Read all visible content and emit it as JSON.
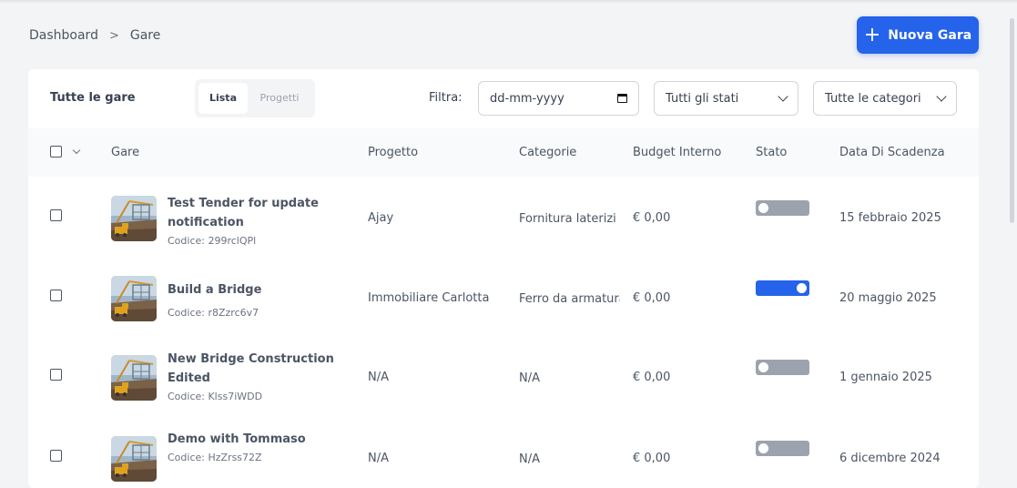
{
  "breadcrumb": {
    "items": [
      "Dashboard",
      "Gare"
    ],
    "separator": ">"
  },
  "header": {
    "new_button_label": "Nuova Gara",
    "new_button_icon": "plus-icon"
  },
  "toolbar": {
    "title": "Tutte le gare",
    "view_options": [
      "Lista",
      "Progetti"
    ],
    "active_view": "Lista",
    "filter_label": "Filtra:",
    "date_placeholder": "dd-mm-yyyy",
    "status_select": "Tutti gli stati",
    "category_select": "Tutte le categorie"
  },
  "table": {
    "columns": [
      "Gare",
      "Progetto",
      "Categorie",
      "Budget Interno",
      "Stato",
      "Data Di Scadenza"
    ],
    "rows": [
      {
        "name": "Test Tender for update notification",
        "code": "Codice: 299rclQPl",
        "project": "Ajay",
        "category": "Fornitura laterizi",
        "budget": "€ 0,00",
        "status_on": false,
        "deadline": "15 febbraio 2025"
      },
      {
        "name": "Build a Bridge",
        "code": "Codice: r8Zzrc6v7",
        "project": "Immobiliare Carlotta",
        "category": "Ferro da armatura",
        "budget": "€ 0,00",
        "status_on": true,
        "deadline": "20 maggio 2025"
      },
      {
        "name": "New Bridge Construction Edited",
        "code": "Codice: Klss7iWDD",
        "project": "N/A",
        "category": "N/A",
        "budget": "€ 0,00",
        "status_on": false,
        "deadline": "1 gennaio 2025"
      },
      {
        "name": "Demo with Tommaso",
        "code": "Codice: HzZrss72Z",
        "project": "N/A",
        "category": "N/A",
        "budget": "€ 0,00",
        "status_on": false,
        "deadline": "6 dicembre 2024"
      }
    ]
  },
  "colors": {
    "accent": "#2563eb",
    "toggle_off": "#9ca3af",
    "background": "#f3f4f6"
  }
}
